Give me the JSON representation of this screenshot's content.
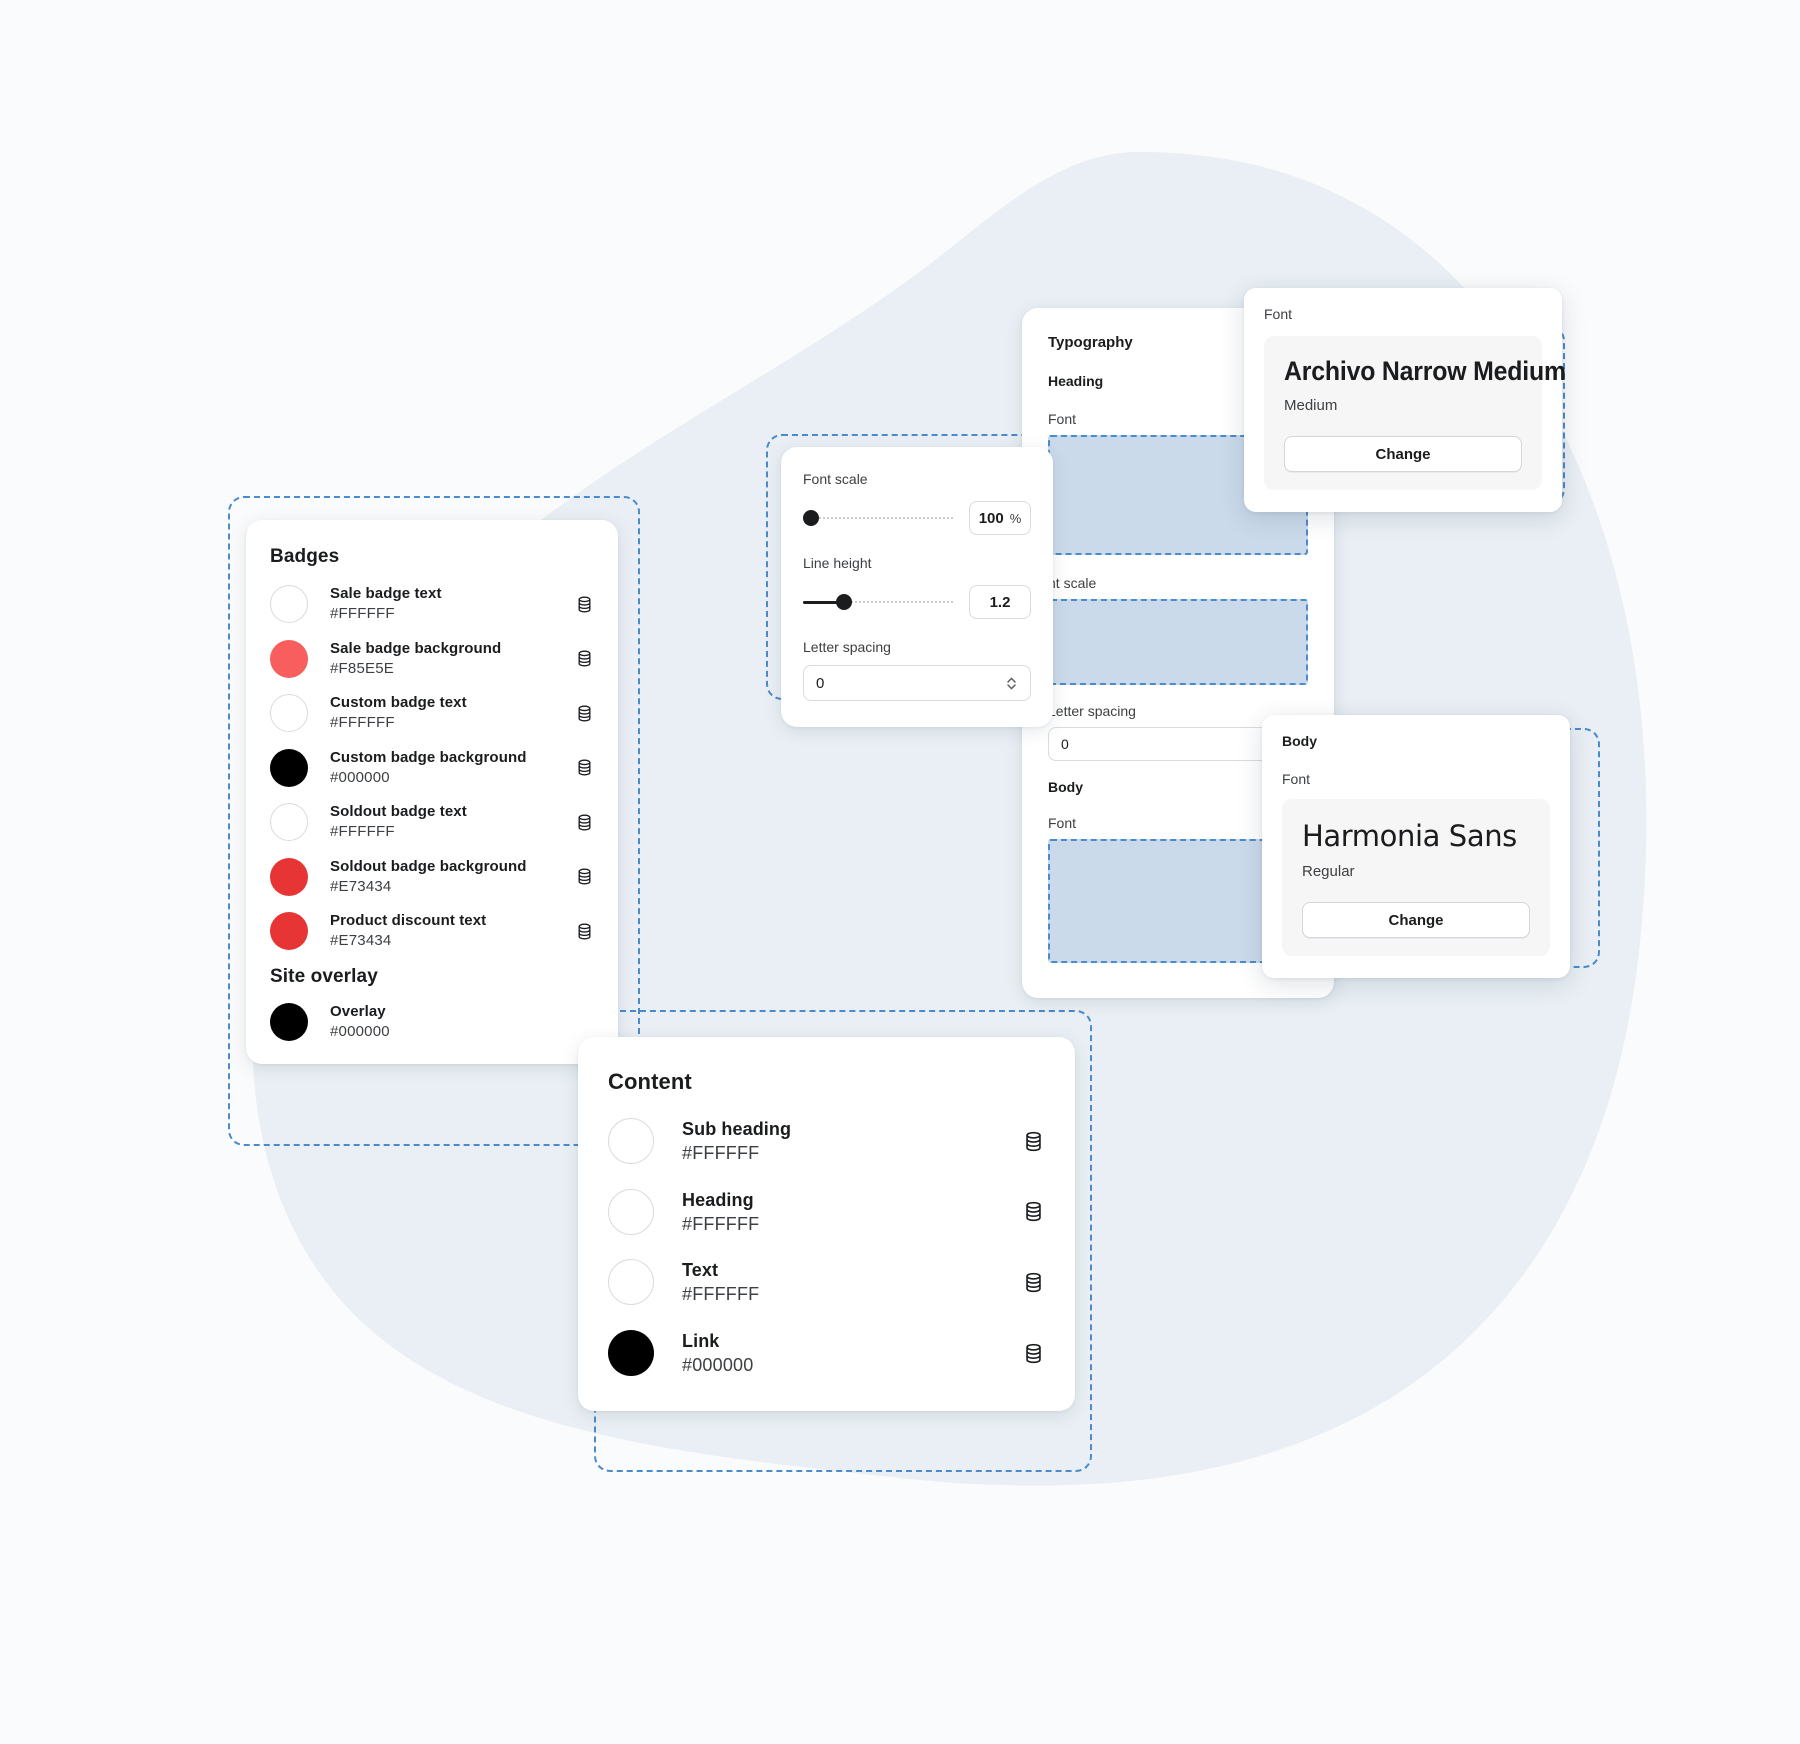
{
  "theme": {
    "page_background": "#FAFBFC",
    "blob_color": "#E9EFF4",
    "selection_outline": "#4A8BCB",
    "selection_fill": "#CBDAEA",
    "card_background": "#FFFFFF"
  },
  "badges_panel": {
    "title": "Badges",
    "icon": "database-icon",
    "items": [
      {
        "name": "Sale badge text",
        "hex": "#FFFFFF",
        "swatch": "#FFFFFF",
        "outlined": true
      },
      {
        "name": "Sale badge background",
        "hex": "#F85E5E",
        "swatch": "#F85E5E",
        "outlined": false
      },
      {
        "name": "Custom badge text",
        "hex": "#FFFFFF",
        "swatch": "#FFFFFF",
        "outlined": true
      },
      {
        "name": "Custom badge background",
        "hex": "#000000",
        "swatch": "#000000",
        "outlined": false
      },
      {
        "name": "Soldout badge text",
        "hex": "#FFFFFF",
        "swatch": "#FFFFFF",
        "outlined": true
      },
      {
        "name": "Soldout badge background",
        "hex": "#E73434",
        "swatch": "#E73434",
        "outlined": false
      },
      {
        "name": "Product discount text",
        "hex": "#E73434",
        "swatch": "#E73434",
        "outlined": false
      }
    ],
    "subsection_title": "Site overlay",
    "subsection_items": [
      {
        "name": "Overlay",
        "hex": "#000000",
        "swatch": "#000000",
        "outlined": false
      }
    ]
  },
  "content_panel": {
    "title": "Content",
    "items": [
      {
        "name": "Sub heading",
        "hex": "#FFFFFF",
        "swatch": "#FFFFFF",
        "outlined": true
      },
      {
        "name": "Heading",
        "hex": "#FFFFFF",
        "swatch": "#FFFFFF",
        "outlined": true
      },
      {
        "name": "Text",
        "hex": "#FFFFFF",
        "swatch": "#FFFFFF",
        "outlined": true
      },
      {
        "name": "Link",
        "hex": "#000000",
        "swatch": "#000000",
        "outlined": false
      }
    ]
  },
  "typography_panel": {
    "title": "Typography",
    "heading_group": "Heading",
    "heading_font_label": "Font",
    "font_scale_label": "nt scale",
    "letter_spacing_label": "Letter spacing",
    "letter_spacing_value": "0",
    "body_group": "Body",
    "body_font_label": "Font"
  },
  "font_scale_popover": {
    "font_scale": {
      "label": "Font scale",
      "value": "100",
      "unit": "%",
      "knob_percent": 2
    },
    "line_height": {
      "label": "Line height",
      "value": "1.2",
      "knob_percent": 22
    },
    "letter_spacing": {
      "label": "Letter spacing",
      "value": "0",
      "stepper_icon": "chevron-updown-icon"
    }
  },
  "heading_font_popover": {
    "caption": "Font",
    "font_name": "Archivo Narrow Medium",
    "font_style": "Medium",
    "change_label": "Change"
  },
  "body_font_popover": {
    "group": "Body",
    "caption": "Font",
    "font_name": "Harmonia Sans",
    "font_style": "Regular",
    "change_label": "Change"
  }
}
